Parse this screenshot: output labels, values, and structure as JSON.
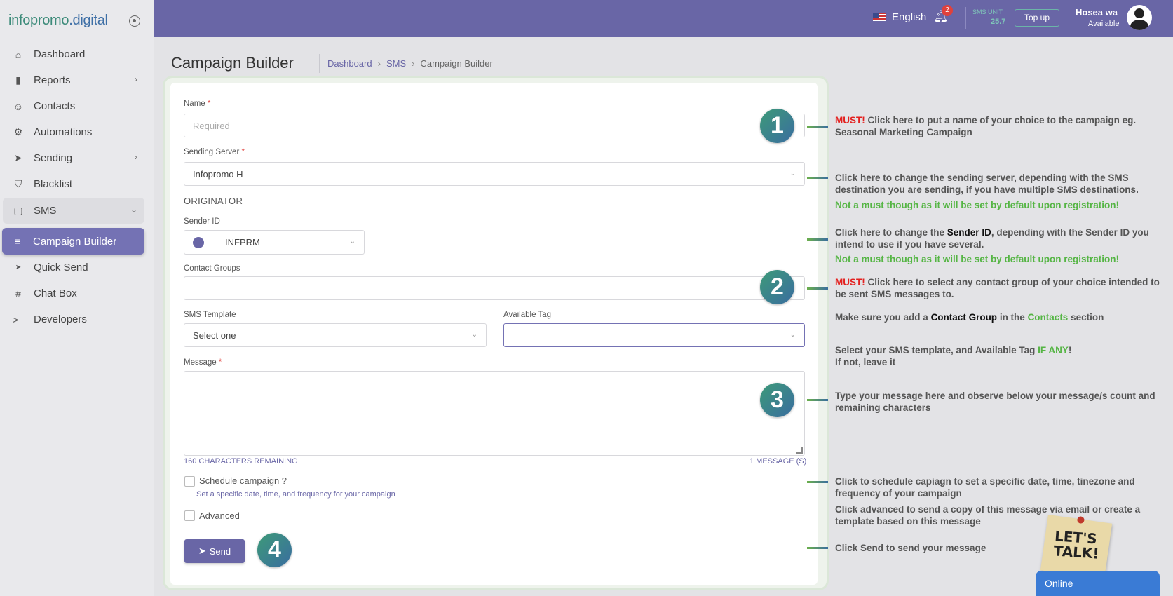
{
  "brand": {
    "part1": "infopromo",
    "part2": ".digital"
  },
  "sidebar": {
    "items": [
      {
        "label": "Dashboard",
        "icon": "home-icon"
      },
      {
        "label": "Reports",
        "icon": "bar-chart-icon"
      },
      {
        "label": "Contacts",
        "icon": "user-icon"
      },
      {
        "label": "Automations",
        "icon": "cpu-icon"
      },
      {
        "label": "Sending",
        "icon": "send-icon"
      },
      {
        "label": "Blacklist",
        "icon": "shield-icon"
      },
      {
        "label": "SMS",
        "icon": "message-square-icon"
      },
      {
        "label": "Campaign Builder",
        "icon": "list-icon"
      },
      {
        "label": "Quick Send",
        "icon": "send-icon"
      },
      {
        "label": "Chat Box",
        "icon": "slack-icon"
      },
      {
        "label": "Developers",
        "icon": "terminal-icon"
      }
    ]
  },
  "topbar": {
    "language": "English",
    "notifications": "2",
    "sms_unit_label": "SMS UNIT",
    "sms_unit_value": "25.7",
    "topup": "Top up",
    "user_name": "Hosea wa",
    "user_status": "Available"
  },
  "header": {
    "title": "Campaign Builder",
    "breadcrumb": [
      "Dashboard",
      "SMS",
      "Campaign Builder"
    ]
  },
  "form": {
    "name_label": "Name",
    "name_placeholder": "Required",
    "server_label": "Sending Server",
    "server_value": "Infopromo H",
    "originator": "ORIGINATOR",
    "sender_label": "Sender ID",
    "sender_value": "INFPRM",
    "groups_label": "Contact Groups",
    "template_label": "SMS Template",
    "template_value": "Select one",
    "tag_label": "Available Tag",
    "message_label": "Message",
    "chars_remaining": "160 CHARACTERS REMAINING",
    "message_count": "1 MESSAGE (S)",
    "schedule_label": "Schedule campaign ?",
    "schedule_hint": "Set a specific date, time, and frequency for your campaign",
    "advanced_label": "Advanced",
    "send_label": "Send",
    "required_mark": "*"
  },
  "steps": [
    "1",
    "2",
    "3",
    "4"
  ],
  "annotations": {
    "a1": {
      "must": "MUST!",
      "text": " Click here to put a name of your choice to the campaign eg. Seasonal Marketing Campaign"
    },
    "a2": {
      "text": "Click here to change the sending server, depending with the SMS destination you are sending, if you have multiple SMS destinations.",
      "note": "Not a must though as it will be set by default upon registration!"
    },
    "a3": {
      "pre": "Click here to change the ",
      "bold": "Sender ID",
      "post": ", depending with the Sender ID you intend to use if you have several.",
      "note": "Not a must though as it will be set by default upon registration!"
    },
    "a4": {
      "must": "MUST!",
      "text": " Click here to select any contact group of your choice intended to be sent SMS messages to."
    },
    "a5": {
      "pre": "Make sure you add a ",
      "bold": "Contact Group",
      "mid": " in the ",
      "green": "Contacts",
      "post": " section"
    },
    "a6": {
      "pre": "Select your SMS template, and Available Tag ",
      "green": "IF ANY",
      "post": "!",
      "line2": "If not, leave it"
    },
    "a7": {
      "text": "Type your message here and observe below your message/s count and remaining characters"
    },
    "a8": {
      "text": "Click to schedule capiagn to set a specific date, time, tinezone and frequency of your campaign"
    },
    "a9": {
      "text": "Click advanced to send a copy of this message via email or create a template based on this message"
    },
    "a10": {
      "text": "Click Send to send your message"
    }
  },
  "chat": {
    "sticky": "LET'S TALK!",
    "status": "Online"
  }
}
